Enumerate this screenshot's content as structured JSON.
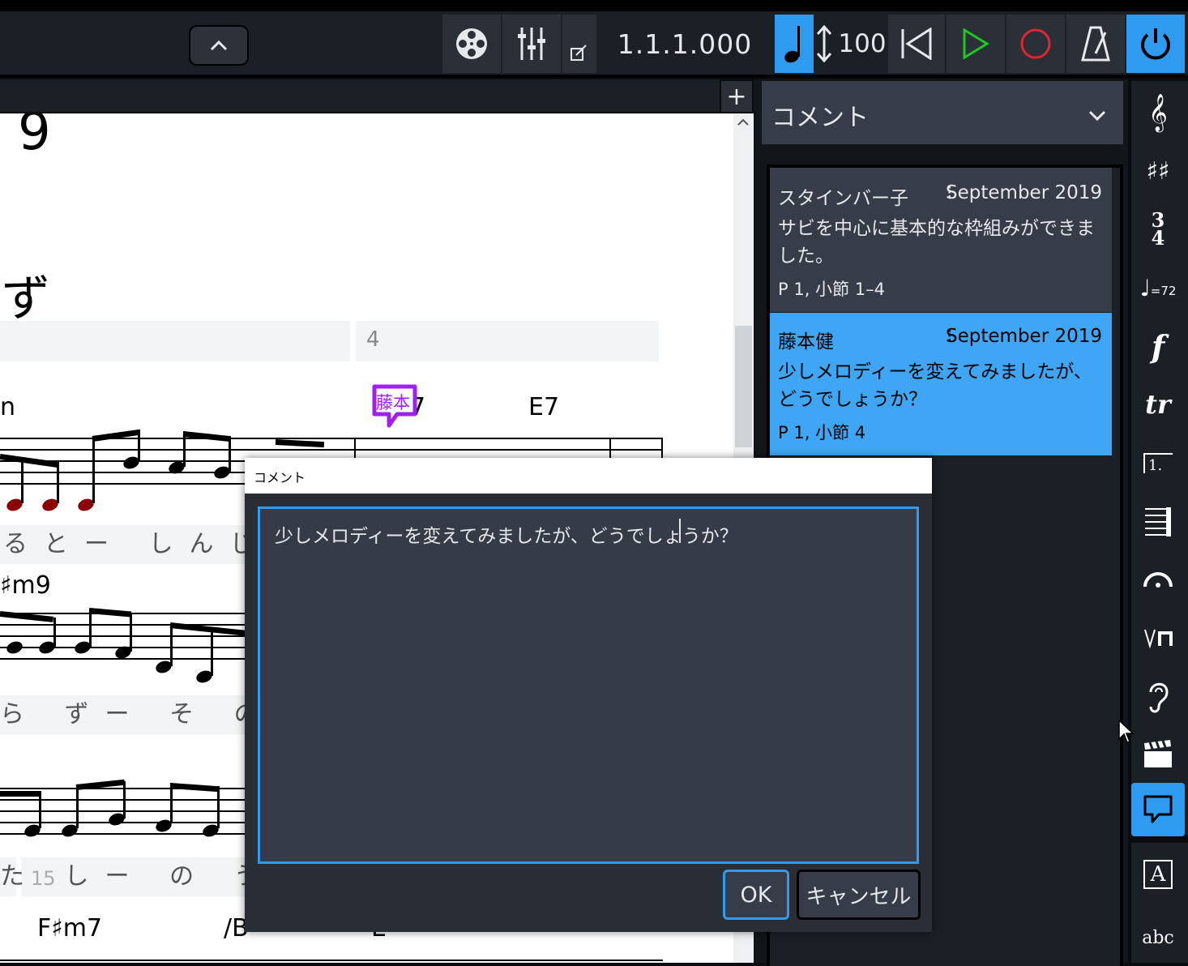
{
  "toolbar": {
    "position": "1.1.1.000",
    "tempo_value": "100",
    "colors": {
      "accent": "#2f9bf0",
      "play": "#1ec81e",
      "record": "#e0262d"
    }
  },
  "score": {
    "page_number": "9",
    "title_fragment": "ず",
    "bar_number": "4",
    "bar_number_bottom": "15",
    "comment_marker": "藤本",
    "chords": {
      "e7": "E7",
      "row1_left": "n",
      "row2_left": "♯m9",
      "row4_a": "F♯m7",
      "row4_b": "/B",
      "row4_c": "E",
      "row1_partial": "7"
    },
    "lyrics": {
      "row1": "るとー しんじ",
      "row2": "ら ずー そ の と き",
      "row3": "た しー の う た"
    }
  },
  "panel": {
    "title": "コメント",
    "comments": [
      {
        "author": "スタインバー子",
        "date": "September 2019",
        "body": "サビを中心に基本的な枠組みができました。",
        "location": "P 1, 小節 1–4"
      },
      {
        "author": "藤本健",
        "date": "September 2019",
        "body": "少しメロディーを変えてみましたが、どうでしょうか？",
        "location": "P 1, 小節 4"
      }
    ]
  },
  "sidebar": {
    "tempo_label": "=72",
    "text_label": "A",
    "lyrics_label": "abc"
  },
  "dialog": {
    "title": "コメント",
    "text": "少しメロディーを変えてみましたが、どうでしょうか？",
    "ok_label": "OK",
    "cancel_label": "キャンセル"
  }
}
